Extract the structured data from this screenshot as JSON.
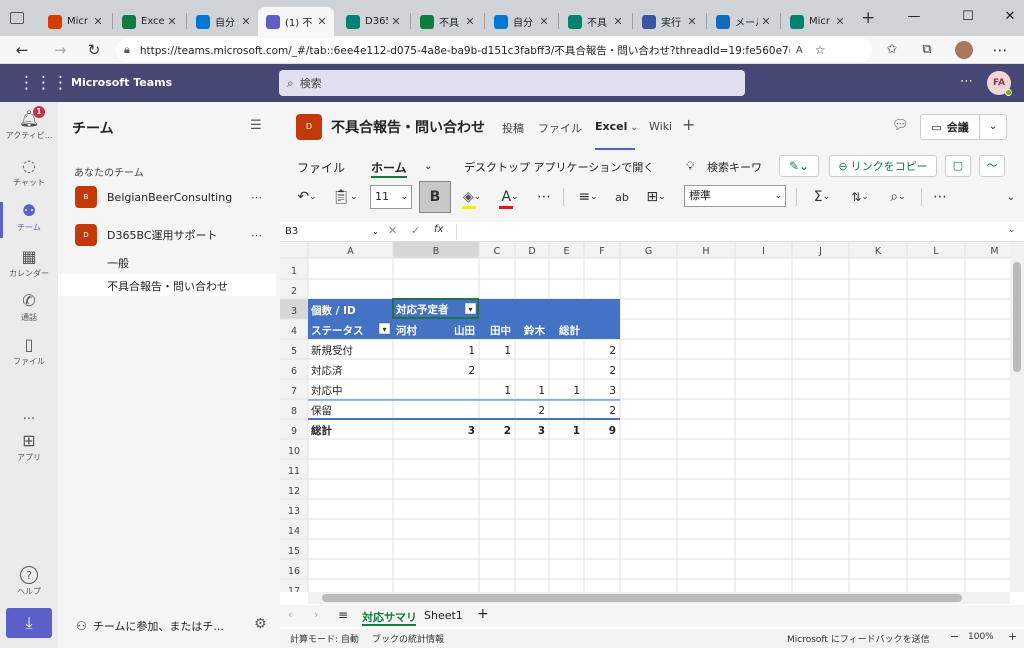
{
  "browser": {
    "tabs": [
      {
        "title": "Micr",
        "color": "#d83b01",
        "active": false
      },
      {
        "title": "Excel",
        "color": "#107c41",
        "active": false
      },
      {
        "title": "自分",
        "color": "#0078d4",
        "active": false
      },
      {
        "title": "(1) 不",
        "color": "#5b5fc7",
        "active": true
      },
      {
        "title": "D365",
        "color": "#008272",
        "active": false
      },
      {
        "title": "不具",
        "color": "#107c41",
        "active": false
      },
      {
        "title": "自分",
        "color": "#0078d4",
        "active": false
      },
      {
        "title": "不具",
        "color": "#008272",
        "active": false
      },
      {
        "title": "実行",
        "color": "#3955a3",
        "active": false
      },
      {
        "title": "メール",
        "color": "#0f6cbd",
        "active": false
      },
      {
        "title": "Micr",
        "color": "#008272",
        "active": false
      }
    ],
    "url": "https://teams.microsoft.com/_#/tab::6ee4e112-d075-4a8e-ba9b-d151c3fabff3/不具合報告・問い合わせ?threadId=19:fe560e7dc5ef4..."
  },
  "teams": {
    "brand": "Microsoft Teams",
    "search_placeholder": "検索",
    "user_initials": "FA"
  },
  "rail": [
    {
      "label": "アクティビ...",
      "icon": "bell-icon",
      "badge": "1"
    },
    {
      "label": "チャット",
      "icon": "chat-icon"
    },
    {
      "label": "チーム",
      "icon": "teams-icon",
      "active": true
    },
    {
      "label": "カレンダー",
      "icon": "calendar-icon"
    },
    {
      "label": "通話",
      "icon": "phone-icon"
    },
    {
      "label": "ファイル",
      "icon": "file-icon"
    },
    {
      "label": "...",
      "icon": "more-icon"
    },
    {
      "label": "アプリ",
      "icon": "apps-icon"
    },
    {
      "label": "ヘルプ",
      "icon": "help-icon"
    }
  ],
  "panel": {
    "title": "チーム",
    "section": "あなたのチーム",
    "teams": [
      {
        "initial": "B",
        "name": "BelgianBeerConsulting"
      },
      {
        "initial": "D",
        "name": "D365BC運用サポート"
      }
    ],
    "channels": [
      "一般",
      "不具合報告・問い合わせ"
    ],
    "join": "チームに参加、またはチ..."
  },
  "channel": {
    "avatar": "D",
    "title": "不具合報告・問い合わせ",
    "tabs": [
      "投稿",
      "ファイル",
      "Excel",
      "Wiki"
    ],
    "meet_label": "会議"
  },
  "ribbon": {
    "tabs": [
      "ファイル",
      "ホーム",
      "デスクトップ アプリケーションで開く",
      "検索キーワ"
    ],
    "copy_link": "リンクをコピー",
    "font_size": "11",
    "number_format": "標準"
  },
  "formula": {
    "namebox": "B3",
    "fx": "fx"
  },
  "sheet": {
    "columns": [
      "A",
      "B",
      "C",
      "D",
      "E",
      "F",
      "G",
      "H",
      "I",
      "J",
      "K",
      "L",
      "M"
    ],
    "rows": [
      "1",
      "2",
      "3",
      "4",
      "5",
      "6",
      "7",
      "8",
      "9",
      "10",
      "11",
      "12",
      "13",
      "14",
      "15",
      "16",
      "17"
    ],
    "pivot": {
      "corner": "個数 / ID",
      "col_field": "対応予定者",
      "row_field": "ステータス",
      "col_headers": [
        "河村",
        "山田",
        "田中",
        "鈴木",
        "総計"
      ],
      "rows": [
        {
          "label": "新規受付",
          "values": [
            "1",
            "1",
            "",
            "",
            "2"
          ]
        },
        {
          "label": "対応済",
          "values": [
            "2",
            "",
            "",
            "",
            "2"
          ]
        },
        {
          "label": "対応中",
          "values": [
            "",
            "1",
            "1",
            "1",
            "3"
          ]
        },
        {
          "label": "保留",
          "values": [
            "",
            "",
            "2",
            "",
            "2"
          ]
        }
      ],
      "total": {
        "label": "総計",
        "values": [
          "3",
          "2",
          "3",
          "1",
          "9"
        ]
      }
    },
    "tabs": [
      "対応サマリ",
      "Sheet1"
    ]
  },
  "status": {
    "calc": "計算モード: 自動",
    "stats": "ブックの統計情報",
    "feedback": "Microsoft にフィードバックを送信",
    "zoom": "100%"
  }
}
